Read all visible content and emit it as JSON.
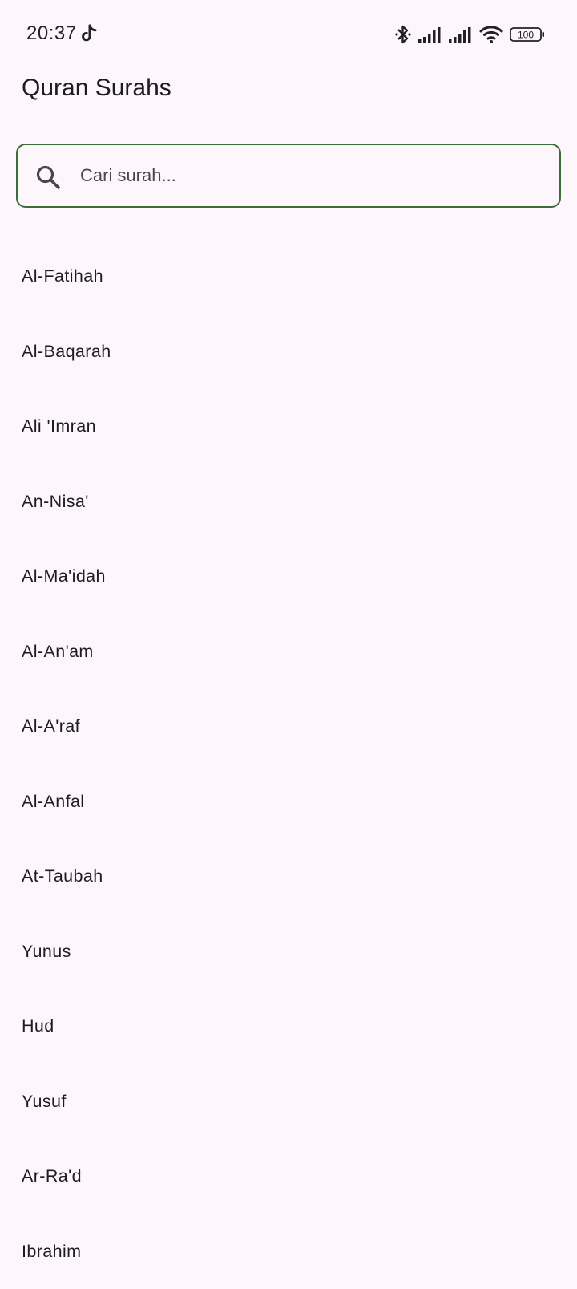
{
  "status_bar": {
    "time": "20:37",
    "battery": "100"
  },
  "header": {
    "title": "Quran Surahs"
  },
  "search": {
    "placeholder": "Cari surah...",
    "value": ""
  },
  "surahs": [
    "Al-Fatihah",
    "Al-Baqarah",
    "Ali 'Imran",
    "An-Nisa'",
    "Al-Ma'idah",
    "Al-An'am",
    "Al-A'raf",
    "Al-Anfal",
    "At-Taubah",
    "Yunus",
    "Hud",
    "Yusuf",
    "Ar-Ra'd",
    "Ibrahim"
  ]
}
